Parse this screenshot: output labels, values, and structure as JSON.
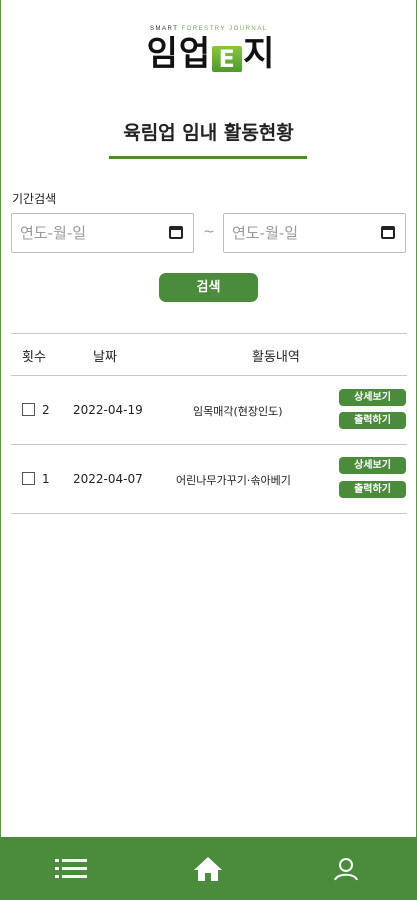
{
  "logo": {
    "subtitle_part1": "SMART",
    "subtitle_part2": "FORESTRY JOURNAL",
    "name_before": "임업",
    "name_e": "E",
    "name_after": "지"
  },
  "page": {
    "title": "육림업 임내 활동현황"
  },
  "search": {
    "period_label": "기간검색",
    "from_placeholder": "연도-월-일",
    "to_placeholder": "연도-월-일",
    "separator": "~",
    "button_label": "검색"
  },
  "table": {
    "headers": {
      "count": "횟수",
      "date": "날짜",
      "activity": "활동내역"
    },
    "rows": [
      {
        "count": "2",
        "date": "2022-04-19",
        "activity": "임목매각(현장인도)",
        "detail_label": "상세보기",
        "print_label": "출력하기"
      },
      {
        "count": "1",
        "date": "2022-04-07",
        "activity": "어린나무가꾸기·솎아베기",
        "detail_label": "상세보기",
        "print_label": "출력하기"
      }
    ]
  },
  "bottom_nav": {
    "items": [
      {
        "icon": "menu-icon"
      },
      {
        "icon": "home-icon"
      },
      {
        "icon": "user-icon"
      }
    ]
  },
  "colors": {
    "accent": "#4a8b3c",
    "underline": "#4a8b2c"
  }
}
